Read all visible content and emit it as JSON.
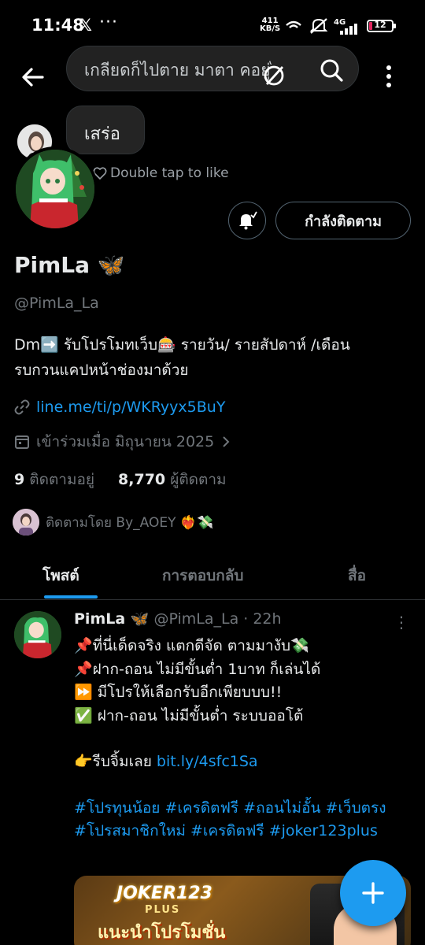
{
  "status_bar": {
    "time": "11:48",
    "x_logo": "𝕏",
    "more": "···",
    "speed_top": "411",
    "speed_bottom": "KB/S",
    "network": "4G",
    "battery": "12"
  },
  "header": {
    "search_text": "เกลียดก็ไปตาย มาตา คอยู่ไ้"
  },
  "overlay": {
    "reply_text": "เสร่อ",
    "double_tap": "Double tap to like"
  },
  "profile": {
    "follow_button": "กำลังติดตาม",
    "name": "PimLa 🦋",
    "handle": "@PimLa_La",
    "bio_line1": "Dm➡️ รับโปรโมทเว็บ🎰 รายวัน/ รายสัปดาห์ /เดือน",
    "bio_line2": "รบกวนแคปหน้าช่องมาด้วย",
    "link": "line.me/ti/p/WKRyyx5BuY",
    "joined": "เข้าร่วมเมื่อ มิถุนายน 2025",
    "following_count": "9",
    "following_label": "ติดตามอยู่",
    "followers_count": "8,770",
    "followers_label": "ผู้ติดตาม",
    "followed_by": "ติดตามโดย By_AOEY ❤️‍🔥💸"
  },
  "tabs": [
    {
      "label": "โพสต์",
      "active": true
    },
    {
      "label": "การตอบกลับ",
      "active": false
    },
    {
      "label": "สื่อ",
      "active": false
    }
  ],
  "post": {
    "name": "PimLa 🦋",
    "handle_time": "@PimLa_La · 22h",
    "lines": [
      "📌ที่นี่เด็ดจริง แตกดีจัด ตามมางับ💸",
      "📌ฝาก-ถอน ไม่มีขั้นต่ำ 1บาท ก็เล่นได้",
      "⏩ มีโปรให้เลือกรับอีกเพียบบบ!!",
      "✅ ฝาก-ถอน ไม่มีขั้นต่ำ ระบบออโต้"
    ],
    "cta_prefix": "👉รีบจิ้มเลย ",
    "cta_link": "bit.ly/4sfc1Sa",
    "hashtags": "#โปรทุนน้อย #เครดิตฟรี #ถอนไม่อั้น #เว็บตรง #โปรสมาชิกใหม่ #เครดิตฟรี #joker123plus",
    "media_logo": "JOKER123",
    "media_logo_sub": "PLUS",
    "media_promo": "แนะนำโปรโมชั่น"
  },
  "colors": {
    "accent": "#1d9bf0",
    "background": "#000000",
    "secondary_text": "#71767b"
  }
}
